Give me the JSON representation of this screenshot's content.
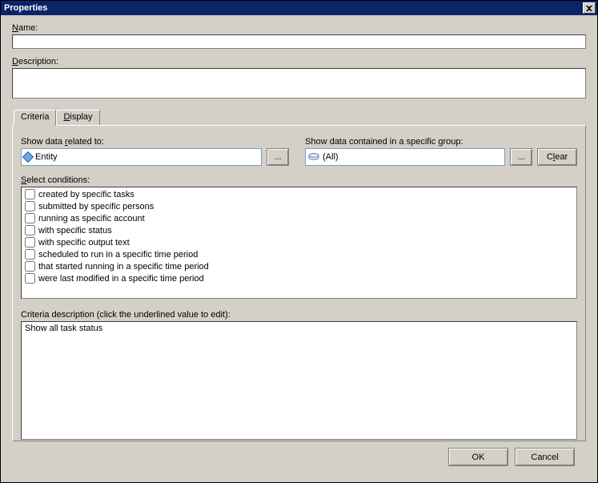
{
  "titlebar": {
    "title": "Properties"
  },
  "labels": {
    "name": "Name:",
    "description": "Description:",
    "show_related": "Show data related to:",
    "show_group": "Show data contained in a specific group:",
    "select_conditions": "Select conditions:",
    "criteria_description": "Criteria description (click the underlined value to edit):",
    "ellipsis": "..."
  },
  "fields": {
    "name_value": "",
    "description_value": "",
    "related_value": "Entity",
    "group_value": "(All)"
  },
  "tabs": {
    "criteria": "Criteria",
    "display": "Display"
  },
  "buttons": {
    "clear": "Clear",
    "ok": "OK",
    "cancel": "Cancel"
  },
  "conditions": [
    {
      "label": "created by specific tasks",
      "checked": false
    },
    {
      "label": "submitted by specific persons",
      "checked": false
    },
    {
      "label": "running as specific account",
      "checked": false
    },
    {
      "label": "with specific status",
      "checked": false
    },
    {
      "label": "with specific output text",
      "checked": false
    },
    {
      "label": "scheduled to run in  a specific time period",
      "checked": false
    },
    {
      "label": "that started running in a specific time period",
      "checked": false
    },
    {
      "label": "were last modified in a specific time period",
      "checked": false
    }
  ],
  "criteria_description_text": "Show all task status",
  "access_keys": {
    "name": "N",
    "description": "D",
    "related": "r",
    "select": "S",
    "clear": "l",
    "display_tab": "D"
  }
}
